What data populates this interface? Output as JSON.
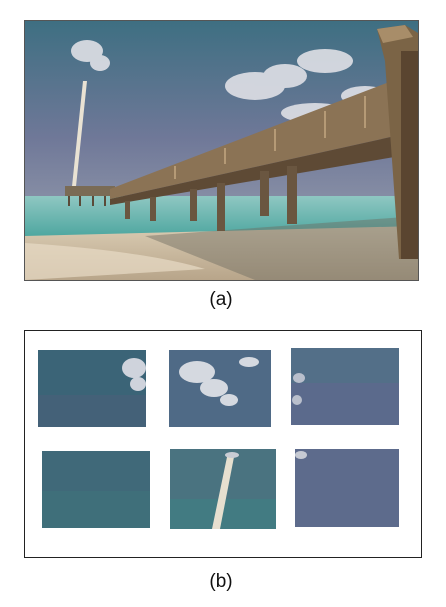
{
  "figure": {
    "caption_a": "(a)",
    "caption_b": "(b)"
  }
}
